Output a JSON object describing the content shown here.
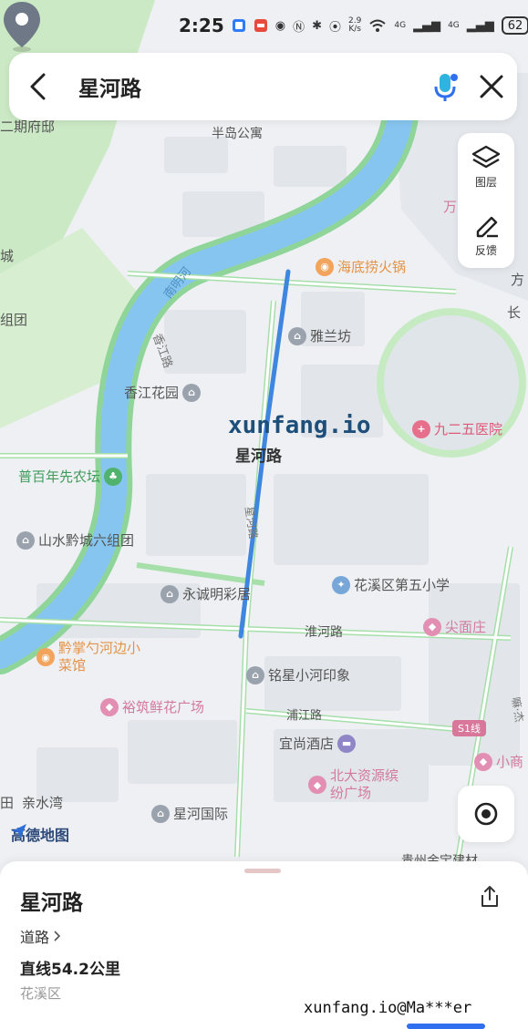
{
  "status_bar": {
    "time": "2:25",
    "network_speed": "2.9 K/s",
    "signal_1": "4G",
    "signal_2": "4G",
    "battery": "62"
  },
  "search": {
    "query": "星河路"
  },
  "tools": {
    "layers_label": "图层",
    "feedback_label": "反馈"
  },
  "map": {
    "pin_label": "星河路",
    "labels": {
      "district_top_left": "二期府邸",
      "banxiao": "半岛公寓",
      "river_nanming": "南明河",
      "river_xiangjiang": "香江路",
      "road_xinghe": "星河路",
      "road_huaihe": "淮河路",
      "road_pujiang": "浦江路",
      "left_edge_1": "城",
      "left_edge_2": "组团",
      "left_edge_3": "田",
      "right_wan": "万",
      "right_fang": "方",
      "right_chang": "长",
      "metro": "S1线",
      "right_rang": "嘛·杰",
      "bottom_partial": "贵州金宝建材"
    },
    "pois": [
      {
        "name": "海底捞火锅",
        "kind": "food"
      },
      {
        "name": "雅兰坊",
        "kind": "res"
      },
      {
        "name": "香江花园",
        "kind": "res"
      },
      {
        "name": "九二五医院",
        "kind": "hosp"
      },
      {
        "name": "普百年先农坛",
        "kind": "green"
      },
      {
        "name": "山水黔城六组团",
        "kind": "res"
      },
      {
        "name": "花溪区第五小学",
        "kind": "edu"
      },
      {
        "name": "永诚明彩居",
        "kind": "res"
      },
      {
        "name": "尖面庄",
        "kind": "shop"
      },
      {
        "name": "黔掌勺河边小菜馆",
        "kind": "food"
      },
      {
        "name": "铭星小河印象",
        "kind": "res"
      },
      {
        "name": "裕筑鲜花广场",
        "kind": "shop"
      },
      {
        "name": "宜尚酒店",
        "kind": "hotel"
      },
      {
        "name": "北大资源缤纷广场",
        "kind": "shop"
      },
      {
        "name": "亲水湾",
        "kind": "res"
      },
      {
        "name": "星河国际",
        "kind": "res"
      },
      {
        "name": "小商",
        "kind": "shop"
      }
    ],
    "brand": "高德地图"
  },
  "watermark": {
    "center": "xunfang.io",
    "bottom": "xunfang.io@Ma***er"
  },
  "sheet": {
    "name": "星河路",
    "type": "道路",
    "distance": "直线54.2公里",
    "district": "花溪区"
  },
  "colors": {
    "river": "#86c5ef",
    "green_space": "#cbe9c4",
    "road_outline": "#a6dfaa",
    "route": "#3f86e0",
    "accent": "#2f6ff0"
  }
}
